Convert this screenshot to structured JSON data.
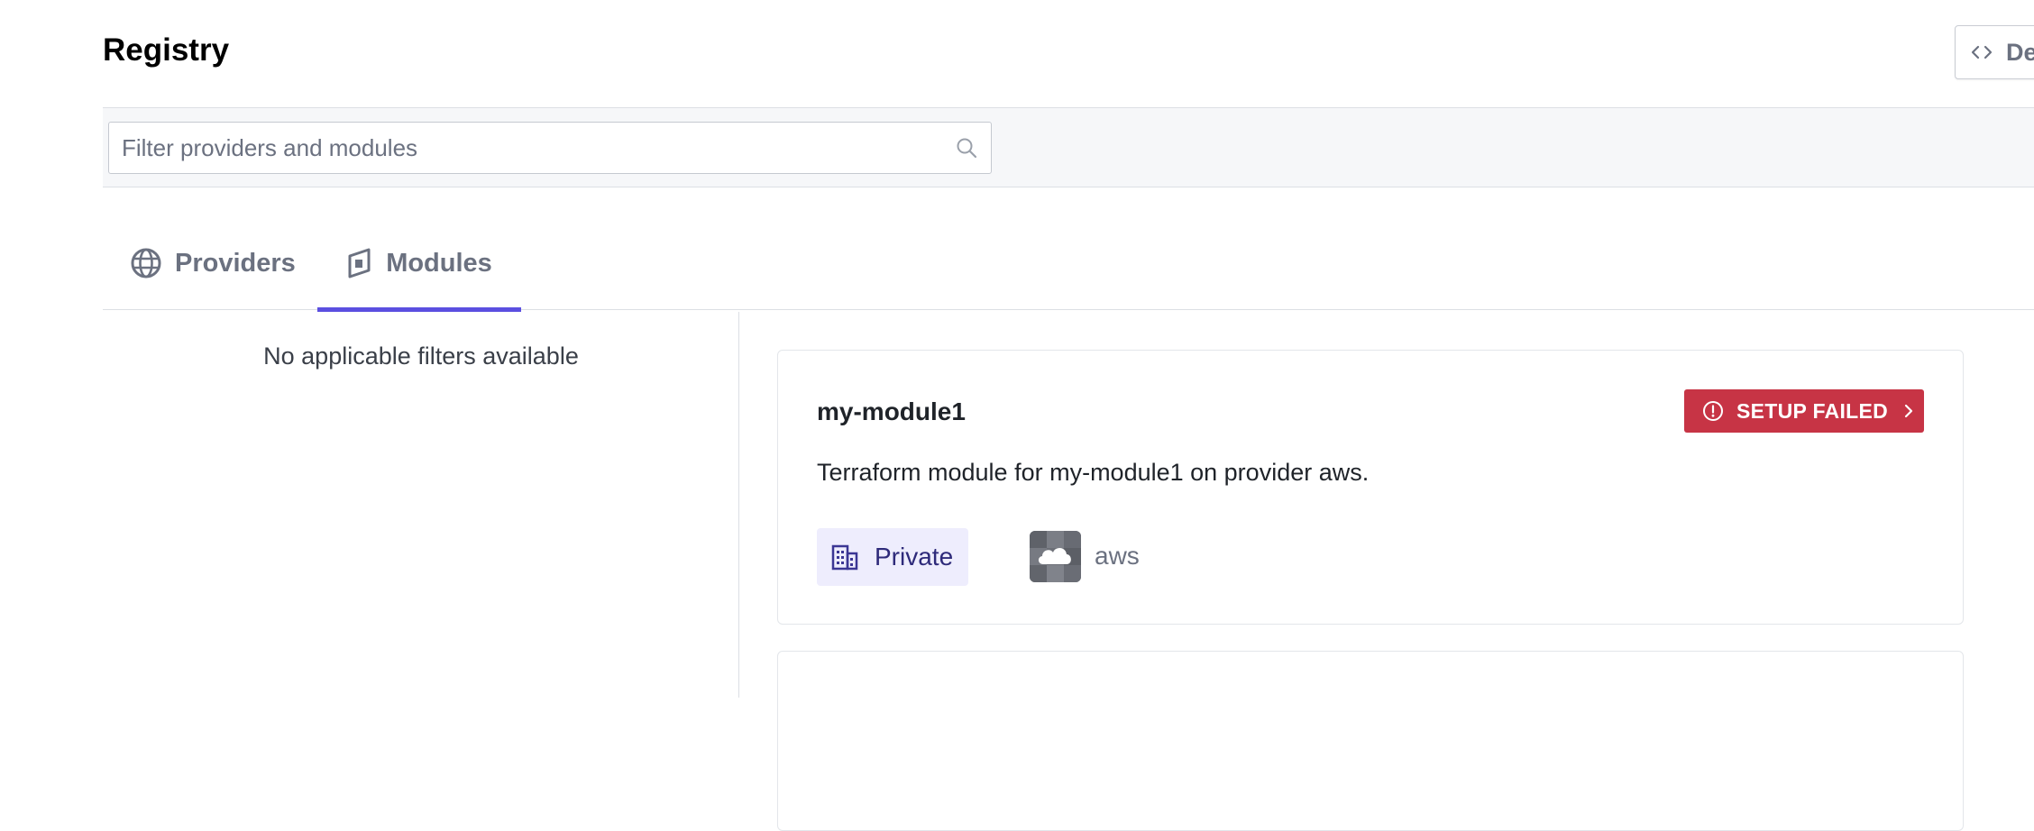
{
  "header": {
    "title": "Registry",
    "dev_button": {
      "label": "De",
      "icon": "code-icon"
    }
  },
  "search": {
    "placeholder": "Filter providers and modules",
    "value": "",
    "icon": "search-icon"
  },
  "tabs": [
    {
      "label": "Providers",
      "icon": "globe-icon",
      "active": false
    },
    {
      "label": "Modules",
      "icon": "module-icon",
      "active": true
    }
  ],
  "sidebar": {
    "empty_message": "No applicable filters available"
  },
  "modules": [
    {
      "name": "my-module1",
      "status": {
        "label": "SETUP FAILED",
        "icon": "alert-circle-icon",
        "color": "#c73445"
      },
      "description": "Terraform module for my-module1 on provider aws.",
      "visibility": {
        "label": "Private",
        "icon": "building-icon",
        "color": "#2e2a7a"
      },
      "provider": {
        "name": "aws",
        "icon": "cloud-icon"
      }
    }
  ],
  "colors": {
    "accent": "#5b4fe0",
    "danger": "#c73445",
    "muted_text": "#6b7180",
    "private_bg": "#eeedfd"
  }
}
